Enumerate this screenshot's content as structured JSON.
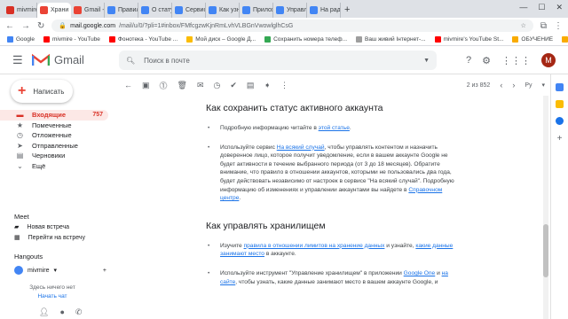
{
  "tabs": [
    {
      "label": "mivmire",
      "color": "#d93025"
    },
    {
      "label": "Храни",
      "color": "#ea4335",
      "active": true
    },
    {
      "label": "Gmail - X",
      "color": "#ea4335"
    },
    {
      "label": "Правила",
      "color": "#4285f4"
    },
    {
      "label": "О статусе",
      "color": "#4285f4"
    },
    {
      "label": "Сервисы",
      "color": "#4285f4"
    },
    {
      "label": "Как узнать",
      "color": "#4285f4"
    },
    {
      "label": "Приложе",
      "color": "#4285f4"
    },
    {
      "label": "Управле",
      "color": "#4285f4"
    },
    {
      "label": "На радос",
      "color": "#4285f4"
    }
  ],
  "address": {
    "host": "mail.google.com",
    "path": "/mail/u/0/?pli=1#inbox/FMfcgzwKjnRmLvhVLBGnVwowlglhCsG"
  },
  "bookmarks": [
    {
      "label": "Google",
      "color": "#4285f4"
    },
    {
      "label": "mivmire - YouTube",
      "color": "#ff0000"
    },
    {
      "label": "Фонотека - YouTube ...",
      "color": "#ff0000"
    },
    {
      "label": "Мой диск – Google Д...",
      "color": "#fbbc04"
    },
    {
      "label": "Сохранить номера телеф...",
      "color": "#34a853"
    },
    {
      "label": "Ваш живий Інтернет-...",
      "color": "#9e9e9e"
    },
    {
      "label": "mivmire's YouTube St...",
      "color": "#ff0000"
    },
    {
      "label": "ОБУЧЕНИЕ",
      "color": "#f9ab00"
    },
    {
      "label": "отдых",
      "color": "#f9ab00"
    }
  ],
  "gmail": {
    "title": "Gmail",
    "search_placeholder": "Поиск в почте",
    "avatar_letter": "М"
  },
  "compose_label": "Написать",
  "nav": [
    {
      "icon": "▬",
      "label": "Входящие",
      "count": "757",
      "selected": true
    },
    {
      "icon": "★",
      "label": "Помеченные"
    },
    {
      "icon": "◷",
      "label": "Отложенные"
    },
    {
      "icon": "➤",
      "label": "Отправленные"
    },
    {
      "icon": "▤",
      "label": "Черновики"
    },
    {
      "icon": "⌄",
      "label": "Ещё"
    }
  ],
  "meet": {
    "title": "Meet",
    "new_meeting": "Новая встреча",
    "join": "Перейти на встречу"
  },
  "hangouts": {
    "title": "Hangouts",
    "user": "mivmire",
    "empty": "Здесь ничего нет",
    "start": "Начать чат"
  },
  "toolbar": {
    "page": "2 из 852",
    "lang": "Ру"
  },
  "article": {
    "h1": "Как сохранить статус активного аккаунта",
    "p1_pre": "Подробную информацию читайте в ",
    "p1_link": "этой статье",
    "p1_post": ".",
    "p2_pre": "Используйте сервис ",
    "p2_link": "На всякий случай",
    "p2_mid": ", чтобы управлять контентом и назначить доверенное лицо, которое получит уведомление, если в вашем аккаунте Google не будет активности в течение выбранного периода (от 3 до 18 месяцев). Обратите внимание, что правило в отношении аккаунтов, которыми не пользовались два года, будет действовать независимо от настроек в сервисе \"На всякий случай\". Подробную информацию об изменениях и управлении аккаунтами вы найдете в ",
    "p2_link2": "Справочном центре",
    "p2_post": ".",
    "h2": "Как управлять хранилищем",
    "p3_pre": "Изучите ",
    "p3_link": "правила в отношении лимитов на хранение данных",
    "p3_mid": " и узнайте, ",
    "p3_link2": "какие данные занимают место",
    "p3_post": " в аккаунте.",
    "p4_pre": "Используйте инструмент \"Управление хранилищем\" в приложении ",
    "p4_link": "Google One",
    "p4_mid": " и ",
    "p4_link2": "на сайте",
    "p4_post": ", чтобы узнать, какие данные занимают место в вашем аккаунте Google, и"
  }
}
